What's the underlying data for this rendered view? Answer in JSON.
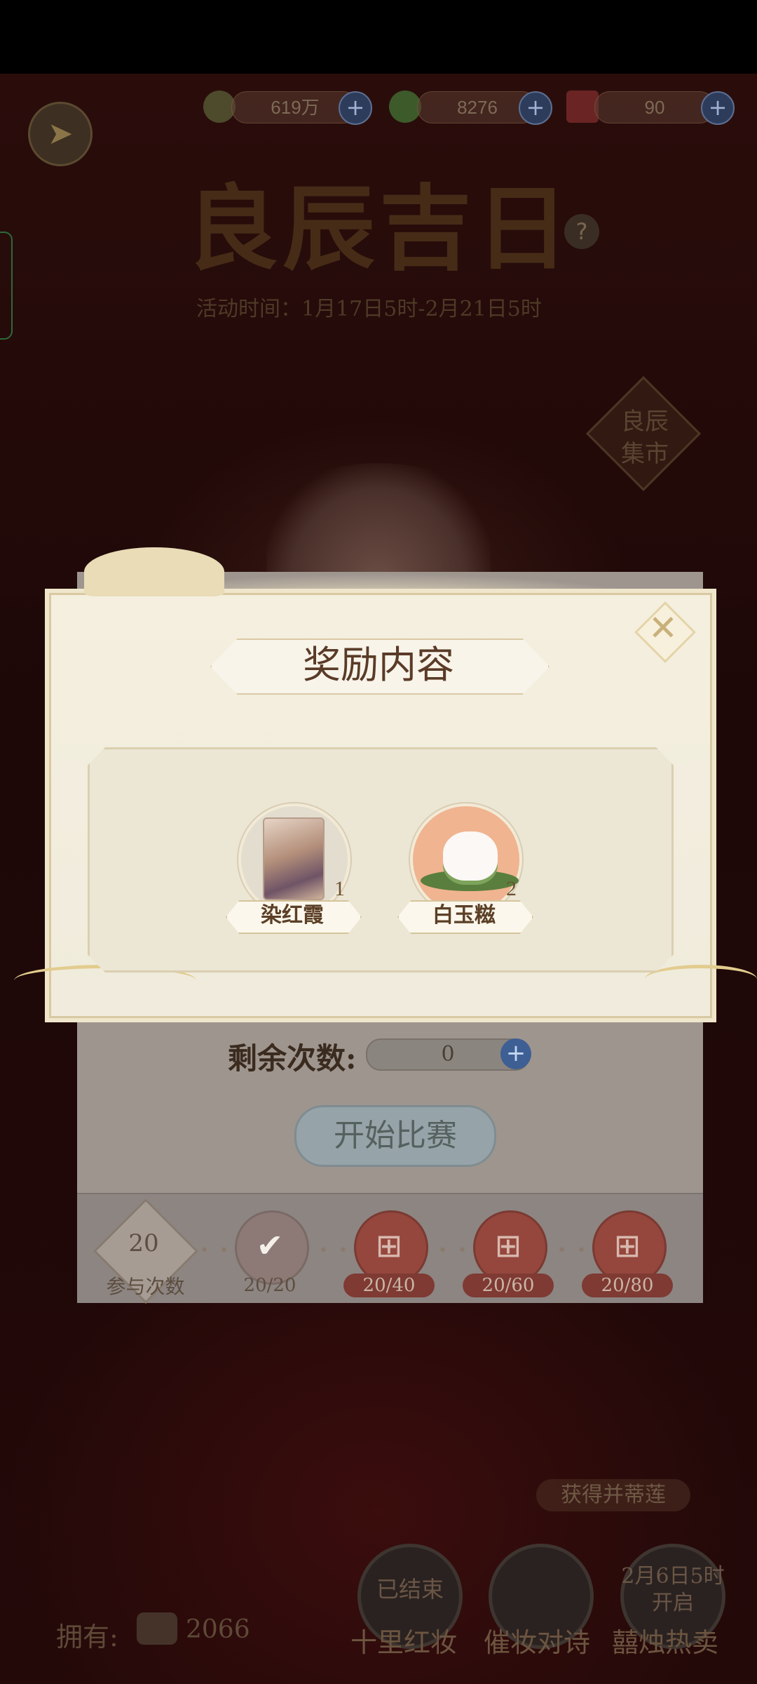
{
  "resources": [
    {
      "icon": "paw-icon",
      "value": "619万"
    },
    {
      "icon": "leaf-bundle-icon",
      "value": "8276"
    },
    {
      "icon": "red-envelope-icon",
      "value": "90"
    }
  ],
  "header": {
    "title": "良辰吉日",
    "time": "活动时间：1月17日5时-2月21日5时",
    "side_badge": "良辰集市"
  },
  "contest": {
    "remaining_label": "剩余次数:",
    "remaining_value": "0",
    "start_label": "开始比赛",
    "participation_count": "20",
    "participation_label": "参与次数",
    "milestones": [
      {
        "label": "20/20",
        "claimed": true
      },
      {
        "label": "20/40",
        "claimed": false
      },
      {
        "label": "20/60",
        "claimed": false
      },
      {
        "label": "20/80",
        "claimed": false
      }
    ]
  },
  "modal": {
    "title": "奖励内容",
    "rewards": [
      {
        "name": "染红霞",
        "count": "1",
        "icon": "scenery-card-icon"
      },
      {
        "name": "白玉糍",
        "count": "2",
        "icon": "cat-rice-cake-icon"
      }
    ]
  },
  "bottom": {
    "chip": "获得并蒂莲",
    "buttons": [
      {
        "status": "已结束",
        "label": "十里红妆"
      },
      {
        "status": "",
        "label": "催妆对诗"
      },
      {
        "status": "2月6日5时开启",
        "label": "囍烛热卖"
      }
    ],
    "own_label": "拥有:",
    "own_value": "2066"
  }
}
